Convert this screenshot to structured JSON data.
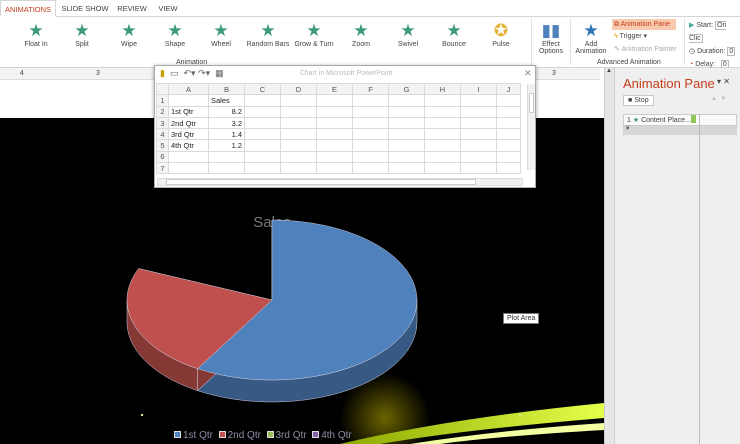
{
  "tabs": [
    "ANIMATIONS",
    "SLIDE SHOW",
    "REVIEW",
    "VIEW"
  ],
  "effects": [
    "Float In",
    "Split",
    "Wipe",
    "Shape",
    "Wheel",
    "Random Bars",
    "Grow & Turn",
    "Zoom",
    "Swivel",
    "Bounce",
    "Pulse"
  ],
  "ribbon": {
    "animation_group": "Animation",
    "effect_options": "Effect Options",
    "add_animation": "Add Animation",
    "animation_pane": "Animation Pane",
    "trigger": "Trigger",
    "animation_painter": "Animation Painter",
    "advanced_group": "Advanced Animation",
    "start_label": "Start:",
    "start_value": "On Clic",
    "duration_label": "Duration:",
    "duration_value": "0",
    "delay_label": "Delay:",
    "delay_value": "0"
  },
  "ruler": [
    "4",
    "3",
    "3"
  ],
  "sheet": {
    "title": "Chart in Microsoft PowerPoint",
    "columns": [
      "A",
      "B",
      "C",
      "D",
      "E",
      "F",
      "G",
      "H",
      "I",
      "J"
    ],
    "rows": [
      [
        "",
        "Sales"
      ],
      [
        "1st Qtr",
        "8.2"
      ],
      [
        "2nd Qtr",
        "3.2"
      ],
      [
        "3rd Qtr",
        "1.4"
      ],
      [
        "4th Qtr",
        "1.2"
      ],
      [
        "",
        ""
      ],
      [
        "",
        ""
      ]
    ]
  },
  "pane": {
    "title": "Animation Pane",
    "stop": "Stop",
    "item_index": "1",
    "item_label": "Content Place..."
  },
  "tooltip": "Plot Area",
  "chart_data": {
    "type": "pie",
    "title": "Sales",
    "categories": [
      "1st Qtr",
      "2nd Qtr",
      "3rd Qtr",
      "4th Qtr"
    ],
    "values": [
      8.2,
      3.2,
      1.4,
      1.2
    ],
    "colors": [
      "#4f81bd",
      "#c0504d",
      "#9bbb59",
      "#8064a2"
    ],
    "visible_slices": 2,
    "legend": "bottom"
  }
}
